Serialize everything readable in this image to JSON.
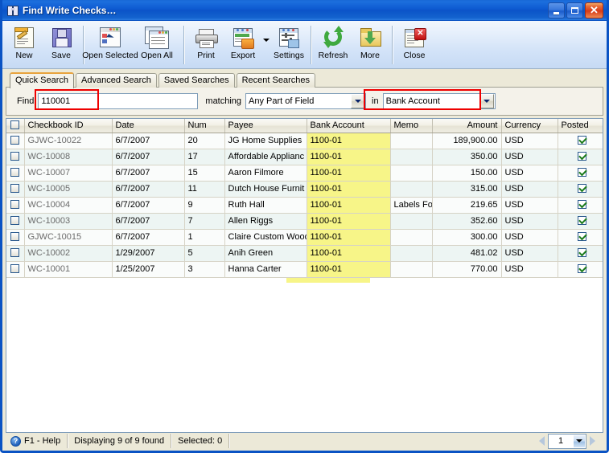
{
  "window": {
    "title": "Find Write Checks…",
    "icon": "binoculars-icon",
    "minimize_label": "Minimize",
    "maximize_label": "Maximize",
    "close_label": "Close"
  },
  "toolbar": {
    "items": [
      {
        "label": "New",
        "icon": "new-document-icon"
      },
      {
        "label": "Save",
        "icon": "save-floppy-icon"
      },
      {
        "label": "Open Selected",
        "icon": "open-selected-icon"
      },
      {
        "label": "Open All",
        "icon": "open-all-icon"
      },
      {
        "label": "Print",
        "icon": "printer-icon"
      },
      {
        "label": "Export",
        "icon": "export-icon"
      },
      {
        "label": "Settings",
        "icon": "settings-icon"
      },
      {
        "label": "Refresh",
        "icon": "refresh-icon"
      },
      {
        "label": "More",
        "icon": "more-download-icon"
      },
      {
        "label": "Close",
        "icon": "close-document-icon"
      }
    ]
  },
  "tabs": [
    {
      "label": "Quick Search",
      "active": true
    },
    {
      "label": "Advanced Search",
      "active": false
    },
    {
      "label": "Saved Searches",
      "active": false
    },
    {
      "label": "Recent Searches",
      "active": false
    }
  ],
  "search": {
    "find_label": "Find",
    "find_value": "110001",
    "find_placeholder": "",
    "matching_label": "matching",
    "matching_value": "Any Part of Field",
    "in_label": "in",
    "in_value": "Bank Account",
    "highlight_color": "#EE0000"
  },
  "grid": {
    "columns": [
      {
        "key": "select",
        "label": ""
      },
      {
        "key": "checkbook",
        "label": "Checkbook ID"
      },
      {
        "key": "date",
        "label": "Date"
      },
      {
        "key": "num",
        "label": "Num"
      },
      {
        "key": "payee",
        "label": "Payee"
      },
      {
        "key": "bank",
        "label": "Bank Account"
      },
      {
        "key": "memo",
        "label": "Memo"
      },
      {
        "key": "amount",
        "label": "Amount"
      },
      {
        "key": "currency",
        "label": "Currency"
      },
      {
        "key": "posted",
        "label": "Posted"
      }
    ],
    "match_highlight_color": "#F7F588",
    "rows": [
      {
        "checkbook": "GJWC-10022",
        "date": "6/7/2007",
        "num": "20",
        "payee": "JG Home Supplies",
        "bank": "1100-01",
        "memo": "",
        "amount": "189,900.00",
        "currency": "USD",
        "posted": true
      },
      {
        "checkbook": "WC-10008",
        "date": "6/7/2007",
        "num": "17",
        "payee": "Affordable Applianc",
        "bank": "1100-01",
        "memo": "",
        "amount": "350.00",
        "currency": "USD",
        "posted": true
      },
      {
        "checkbook": "WC-10007",
        "date": "6/7/2007",
        "num": "15",
        "payee": "Aaron  Filmore",
        "bank": "1100-01",
        "memo": "",
        "amount": "150.00",
        "currency": "USD",
        "posted": true
      },
      {
        "checkbook": "WC-10005",
        "date": "6/7/2007",
        "num": "11",
        "payee": "Dutch House Furnit",
        "bank": "1100-01",
        "memo": "",
        "amount": "315.00",
        "currency": "USD",
        "posted": true
      },
      {
        "checkbook": "WC-10004",
        "date": "6/7/2007",
        "num": "9",
        "payee": "Ruth Hall",
        "bank": "1100-01",
        "memo": "Labels Fo",
        "amount": "219.65",
        "currency": "USD",
        "posted": true
      },
      {
        "checkbook": "WC-10003",
        "date": "6/7/2007",
        "num": "7",
        "payee": "Allen Riggs",
        "bank": "1100-01",
        "memo": "",
        "amount": "352.60",
        "currency": "USD",
        "posted": true
      },
      {
        "checkbook": "GJWC-10015",
        "date": "6/7/2007",
        "num": "1",
        "payee": "Claire Custom Wood",
        "bank": "1100-01",
        "memo": "",
        "amount": "300.00",
        "currency": "USD",
        "posted": true
      },
      {
        "checkbook": "WC-10002",
        "date": "1/29/2007",
        "num": "5",
        "payee": "Anih  Green",
        "bank": "1100-01",
        "memo": "",
        "amount": "481.02",
        "currency": "USD",
        "posted": true
      },
      {
        "checkbook": "WC-10001",
        "date": "1/25/2007",
        "num": "3",
        "payee": "Hanna  Carter",
        "bank": "1100-01",
        "memo": "",
        "amount": "770.00",
        "currency": "USD",
        "posted": true
      }
    ]
  },
  "statusbar": {
    "help": "F1 - Help",
    "displaying": "Displaying 9 of 9 found",
    "selected": "Selected: 0",
    "page_value": "1",
    "prev_label": "Previous page",
    "next_label": "Next page"
  }
}
